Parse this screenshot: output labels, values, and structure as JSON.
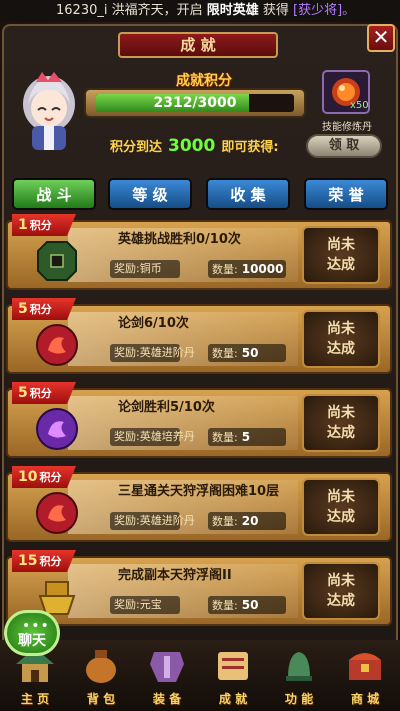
{
  "ticker": {
    "prefix": "16230_i",
    "mid": " 洪福齐天，开启 ",
    "hero": "限时英雄",
    "get": " 获得 ",
    "item": "[获少将]。"
  },
  "header": {
    "title": "成 就",
    "close_icon": "✕"
  },
  "score": {
    "label": "成就积分",
    "current": 2312,
    "total": 3000,
    "text": "2312/3000",
    "progress": 0.771,
    "reach_prefix": "积分到达",
    "reach_value": "3000",
    "reach_suffix": "即可获得:",
    "reward_name": "技能修炼丹",
    "reward_count": "x50",
    "claim_label": "领 取"
  },
  "tabs": [
    {
      "label": "战 斗",
      "active": true
    },
    {
      "label": "等 级",
      "active": false
    },
    {
      "label": "收 集",
      "active": false
    },
    {
      "label": "荣 誉",
      "active": false
    }
  ],
  "tasks": [
    {
      "points": "1",
      "points_label": "积分",
      "title": "英雄挑战胜利0/10次",
      "reward_label": "奖励:",
      "reward_item": "铜币",
      "qty_label": "数量:",
      "qty": "10000",
      "status": [
        "尚未",
        "达成"
      ],
      "icon": "coin-icon"
    },
    {
      "points": "5",
      "points_label": "积分",
      "title": "论剑6/10次",
      "reward_label": "奖励:",
      "reward_item": "英雄进阶丹",
      "qty_label": "数量:",
      "qty": "50",
      "status": [
        "尚未",
        "达成"
      ],
      "icon": "advance-pill-icon"
    },
    {
      "points": "5",
      "points_label": "积分",
      "title": "论剑胜利5/10次",
      "reward_label": "奖励:",
      "reward_item": "英雄培养丹",
      "qty_label": "数量:",
      "qty": "5",
      "status": [
        "尚未",
        "达成"
      ],
      "icon": "train-pill-icon"
    },
    {
      "points": "10",
      "points_label": "积分",
      "title": "三星通关天狩浮阁困难10层",
      "reward_label": "奖励:",
      "reward_item": "英雄进阶丹",
      "qty_label": "数量:",
      "qty": "20",
      "status": [
        "尚未",
        "达成"
      ],
      "icon": "advance-pill-icon"
    },
    {
      "points": "15",
      "points_label": "积分",
      "title": "完成副本天狩浮阁II",
      "reward_label": "奖励:",
      "reward_item": "元宝",
      "qty_label": "数量:",
      "qty": "50",
      "status": [
        "尚未",
        "达成"
      ],
      "icon": "ingot-icon"
    }
  ],
  "chat": {
    "label": "聊天",
    "dots": "•••"
  },
  "nav": [
    {
      "label": "主 页"
    },
    {
      "label": "背 包"
    },
    {
      "label": "装 备"
    },
    {
      "label": "成 就"
    },
    {
      "label": "功 能"
    },
    {
      "label": "商 城"
    }
  ],
  "colors": {
    "accent_gold": "#ffd24a",
    "progress": "#4fb82c",
    "tab_active": "#3fae32",
    "tab_inactive": "#2a6fb2",
    "badge_red": "#c7231b"
  }
}
